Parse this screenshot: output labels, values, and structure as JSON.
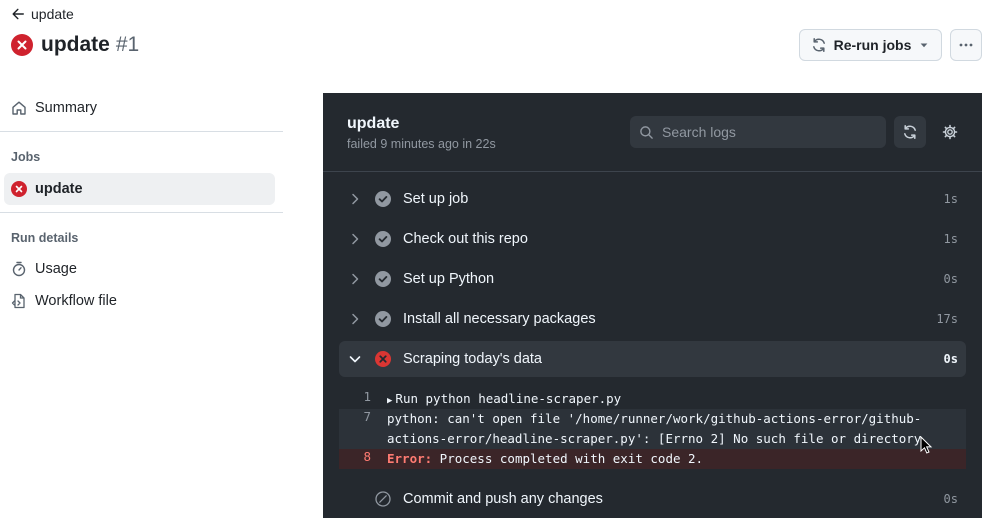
{
  "header": {
    "back_label": "update",
    "title": "update",
    "run_number": "#1",
    "rerun_label": "Re-run jobs"
  },
  "sidebar": {
    "summary_label": "Summary",
    "jobs_heading": "Jobs",
    "active_job": "update",
    "run_details_heading": "Run details",
    "usage_label": "Usage",
    "workflow_label": "Workflow file"
  },
  "panel": {
    "job_title": "update",
    "job_status": "failed 9 minutes ago in 22s",
    "search_placeholder": "Search logs",
    "steps": [
      {
        "name": "Set up job",
        "duration": "1s",
        "status": "success"
      },
      {
        "name": "Check out this repo",
        "duration": "1s",
        "status": "success"
      },
      {
        "name": "Set up Python",
        "duration": "0s",
        "status": "success"
      },
      {
        "name": "Install all necessary packages",
        "duration": "17s",
        "status": "success"
      },
      {
        "name": "Scraping today's data",
        "duration": "0s",
        "status": "failure"
      },
      {
        "name": "Commit and push any changes",
        "duration": "0s",
        "status": "skipped"
      }
    ],
    "log": {
      "line1_num": "1",
      "line1_text": "Run python headline-scraper.py",
      "line7_num": "7",
      "line7_text": "python: can't open file '/home/runner/work/github-actions-error/github-actions-error/headline-scraper.py': [Errno 2] No such file or directory",
      "line8_num": "8",
      "line8_label": "Error:",
      "line8_text": " Process completed with exit code 2."
    }
  },
  "colors": {
    "failure": "#cf222e",
    "panel_bg": "#24292f",
    "success_icon": "#9198a1"
  }
}
